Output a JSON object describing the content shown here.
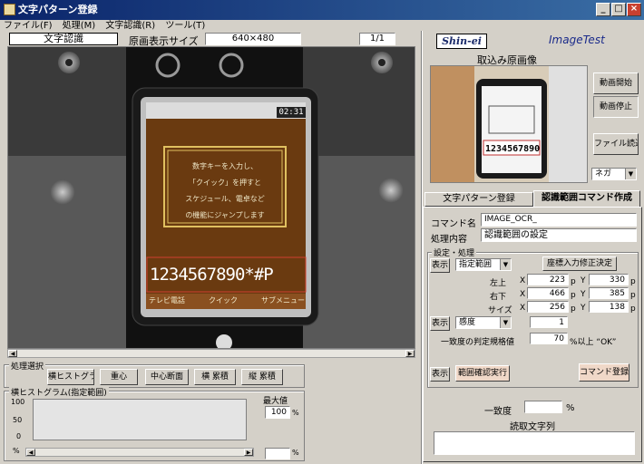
{
  "window": {
    "title": "文字パターン登録",
    "minimize": "_",
    "maximize": "□",
    "close": "×"
  },
  "menu": [
    {
      "label": "ファイル(F)"
    },
    {
      "label": "処理(M)"
    },
    {
      "label": "文字認識(R)"
    },
    {
      "label": "ツール(T)"
    }
  ],
  "header": {
    "mode": "文字認識",
    "image_size_label": "原画表示サイズ",
    "image_size": "640×480",
    "page": "1/1"
  },
  "camera": {
    "phone_clock": "02:31",
    "message_lines": [
      "数字キーを入力し、",
      "「クイック」を押すと",
      "スケジュール、電卓など",
      "の機能にジャンプします"
    ],
    "digits": "1234567890*#P",
    "softkeys": [
      "テレビ電話",
      "クイック",
      "サブメニュー"
    ]
  },
  "processing": {
    "label": "処理選択",
    "buttons": [
      "横ヒストグラム",
      "重心",
      "中心断面",
      "横 累積",
      "縦 累積"
    ]
  },
  "histogram": {
    "label": "横ヒストグラム(指定範囲)",
    "y_ticks": [
      "100",
      "50",
      "0"
    ],
    "x_unit": "%",
    "max_label": "最大値",
    "max_value": "100",
    "percent": "%",
    "bottom_value": "",
    "bottom_unit": "%"
  },
  "brand": {
    "logo": "Shin-ei",
    "app": "ImageTest"
  },
  "preview": {
    "title": "取込み原画像",
    "start_video": "動画開始",
    "stop_video": "動画停止",
    "load_file": "ファイル読込",
    "select_value": "ネガ"
  },
  "tabs": [
    {
      "label": "文字パターン登録",
      "active": false
    },
    {
      "label": "認識範囲コマンド作成",
      "active": true
    }
  ],
  "command": {
    "name_label": "コマンド名",
    "name_value": "IMAGE_OCR_",
    "content_label": "処理内容",
    "content_value": "認識範囲の設定"
  },
  "settings": {
    "group_label": "設定・処理",
    "show1": "表示",
    "range_select": "指定範囲",
    "coord_button": "座標入力修正決定",
    "rows": [
      {
        "label": "左上",
        "xl": "X",
        "x": "223",
        "xu": "p",
        "yl": "Y",
        "y": "330",
        "yu": "p"
      },
      {
        "label": "右下",
        "xl": "X",
        "x": "466",
        "xu": "p",
        "yl": "Y",
        "y": "385",
        "yu": "p"
      },
      {
        "label": "サイズ",
        "xl": "X",
        "x": "256",
        "xu": "p",
        "yl": "Y",
        "y": "138",
        "yu": "p"
      }
    ],
    "show2": "表示",
    "sensitivity_select": "感度",
    "sensitivity_value": "1",
    "match_label": "一致度の判定規格値",
    "match_value": "70",
    "match_suffix": "%以上 “OK”",
    "show3": "表示",
    "run_button": "範囲確認実行",
    "register_button": "コマンド登録"
  },
  "result": {
    "match_label": "一致度",
    "match_value": "",
    "match_unit": "%",
    "text_label": "読取文字列",
    "text_value": ""
  }
}
